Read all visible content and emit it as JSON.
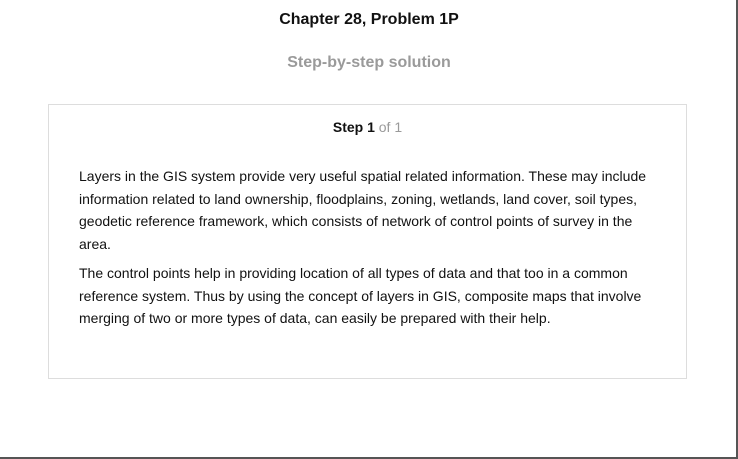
{
  "header": {
    "chapter_title": "Chapter 28, Problem 1P",
    "subtitle": "Step-by-step solution"
  },
  "step": {
    "label": "Step 1",
    "of_text": "of 1",
    "paragraphs": [
      "Layers in the GIS system provide very useful spatial related information. These may include information related to land ownership, floodplains, zoning, wetlands, land cover, soil types, geodetic reference framework, which consists of network of control points of survey in the area.",
      "The control points help in providing location of all types of data and that too in a common reference system. Thus by using the concept of layers in GIS, composite maps that involve merging of two or more types of data, can easily be prepared with their help."
    ]
  },
  "colors": {
    "text": "#111111",
    "muted": "#9a9a9a",
    "card_border": "#dddddd"
  }
}
